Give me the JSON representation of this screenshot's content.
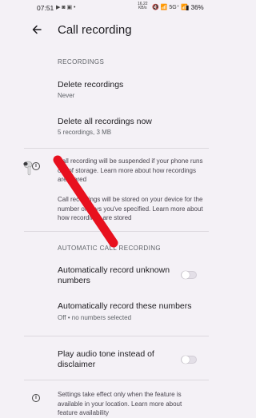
{
  "status_bar": {
    "time": "07:51",
    "left_icons": "▶ ◙ ▣ •",
    "net_speed_value": "16.22",
    "net_speed_unit": "KB/s",
    "right_icons": "🔇 📶 5G⁺ 📶",
    "battery": "36%"
  },
  "header": {
    "title": "Call recording",
    "back_icon": "arrow-back-icon"
  },
  "recordings_section": {
    "header": "RECORDINGS",
    "delete_recordings": {
      "title": "Delete recordings",
      "subtitle": "Never"
    },
    "delete_all": {
      "title": "Delete all recordings now",
      "subtitle": "5 recordings, 3 MB"
    }
  },
  "info_block": {
    "icon": "info-icon",
    "paragraph1": "Call recording will be suspended if your phone runs out of storage. Learn more about how recordings are stored",
    "paragraph2": "Call recordings will be stored on your device for the number of days you've specified. Learn more about how recordings are stored"
  },
  "automatic_section": {
    "header": "AUTOMATIC CALL RECORDING",
    "record_unknown": {
      "title": "Automatically record unknown numbers",
      "toggle_on": false
    },
    "record_these": {
      "title": "Automatically record these numbers",
      "subtitle": "Off • no numbers selected"
    },
    "play_tone": {
      "title": "Play audio tone instead of disclaimer",
      "toggle_on": false
    }
  },
  "footer_info": {
    "icon": "info-icon",
    "text": "Settings take effect only when the feature is available in your location. Learn more about feature availability"
  },
  "colors": {
    "background": "#f4f1f6",
    "stroke": "#e8101e"
  }
}
